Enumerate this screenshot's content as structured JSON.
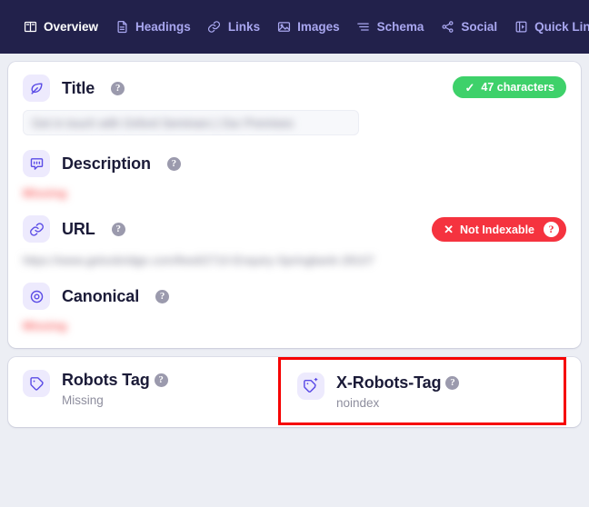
{
  "navbar": {
    "items": [
      {
        "label": "Overview",
        "icon": "book-icon",
        "active": true
      },
      {
        "label": "Headings",
        "icon": "document-icon",
        "active": false
      },
      {
        "label": "Links",
        "icon": "link-icon",
        "active": false
      },
      {
        "label": "Images",
        "icon": "image-icon",
        "active": false
      },
      {
        "label": "Schema",
        "icon": "list-icon",
        "active": false
      },
      {
        "label": "Social",
        "icon": "share-icon",
        "active": false
      },
      {
        "label": "Quick Links",
        "icon": "quick-links-icon",
        "active": false
      }
    ],
    "settings_icon": "sliders-icon",
    "background_color": "#22214b",
    "active_color": "#ffffff",
    "inactive_color": "#a9a7f0"
  },
  "meta_card": {
    "fields": [
      {
        "label": "Title",
        "icon": "leaf-icon",
        "help": "?",
        "value": "Get in touch with Oxford Seminars | Our Premises",
        "value_style": "blurred-box",
        "badge": {
          "text": "47 characters",
          "mark": "✓",
          "color": "#3ed16a",
          "type": "green"
        }
      },
      {
        "label": "Description",
        "icon": "speech-bubble-icon",
        "help": "?",
        "value": "Missing",
        "value_style": "blurred-missing",
        "badge": null
      },
      {
        "label": "URL",
        "icon": "link-chain-icon",
        "help": "?",
        "value": "https://www.getoxbridge.com/feed/2710-Enquiry-Springbank-28107",
        "value_style": "blurred-plain",
        "badge": {
          "text": "Not Indexable",
          "mark": "✕",
          "color": "#f5333f",
          "type": "red",
          "help": "?"
        }
      },
      {
        "label": "Canonical",
        "icon": "target-icon",
        "help": "?",
        "value": "Missing",
        "value_style": "blurred-missing",
        "badge": null
      }
    ]
  },
  "robots_card": {
    "items": [
      {
        "label": "Robots Tag",
        "icon": "tag-icon",
        "help": "?",
        "value": "Missing",
        "highlighted": false
      },
      {
        "label": "X-Robots-Tag",
        "icon": "tag-superscript-icon",
        "help": "?",
        "value": "noindex",
        "highlighted": true
      }
    ],
    "highlight_color": "#f60000"
  }
}
